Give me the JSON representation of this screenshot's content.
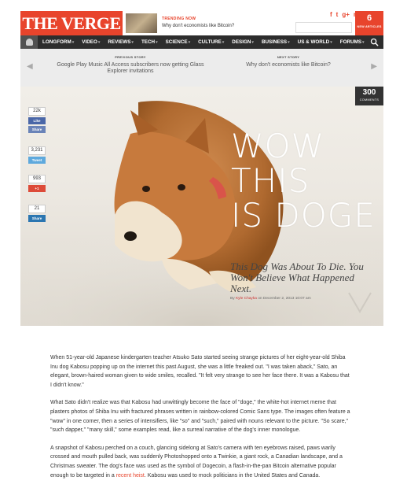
{
  "header": {
    "logo": "THE VERGE",
    "trending_kicker": "TRENDING NOW",
    "trending_title": "Why don't economists like Bitcoin?",
    "social_icons": [
      "f",
      "t",
      "g+",
      "rss"
    ],
    "new_articles_count": "6",
    "new_articles_label": "NEW ARTICLES"
  },
  "nav": {
    "items": [
      "LONGFORM",
      "VIDEO",
      "REVIEWS",
      "TECH",
      "SCIENCE",
      "CULTURE",
      "DESIGN",
      "BUSINESS",
      "US & WORLD",
      "FORUMS"
    ]
  },
  "prevnext": {
    "prev_kicker": "PREVIOUS STORY",
    "prev_title": "Google Play Music All Access subscribers now getting Glass Explorer invitations",
    "next_kicker": "NEXT STORY",
    "next_title": "Why don't economists like Bitcoin?"
  },
  "hero": {
    "title_lines": [
      "WOW",
      "THIS",
      "IS DOGE"
    ],
    "subtitle": "This Dog Was About To Die. You Won't Believe What Happened Next.",
    "byline_prefix": "By",
    "author": "Kyle Chayka",
    "date": "on December 2, 2013 10:07 am",
    "comments_count": "300",
    "comments_label": "COMMENTS"
  },
  "share": {
    "fb_count": "22k",
    "fb_like": "Like",
    "fb_share": "Share",
    "tweet_count": "3,231",
    "tweet_label": "Tweet",
    "gplus_count": "993",
    "gplus_label": "+1",
    "linkedin_count": "21",
    "linkedin_label": "Share"
  },
  "article": {
    "p1": "When 51-year-old Japanese kindergarten teacher Atsuko Sato started seeing strange pictures of her eight-year-old Shiba Inu dog Kabosu popping up on the internet this past August, she was a little freaked out. \"I was taken aback,\" Sato, an elegant, brown-haired woman given to wide smiles, recalled. \"It felt very strange to see her face there. It was a Kabosu that I didn't know.\"",
    "p2": "What Sato didn't realize was that Kabosu had unwittingly become the face of \"doge,\" the white-hot internet meme that plasters photos of Shiba Inu with fractured phrases written in rainbow-colored Comic Sans type. The images often feature a \"wow\" in one corner, then a series of intensifiers, like \"so\" and \"such,\" paired with nouns relevant to the picture. \"So scare,\" \"such dapper,\" \"many skill,\" some examples read, like a surreal narrative of the dog's inner monologue.",
    "p3_start": "A snapshot of Kabosu perched on a couch, glancing sidelong at Sato's camera with ten eyebrows raised, paws warily crossed and mouth pulled back, was suddenly Photoshopped onto a Twinkie, a giant rock, a Canadian landscape, and a Christmas sweater. The dog's face was used as the symbol of Dogecoin, a flash-in-the-pan Bitcoin alternative popular enough to be targeted in a",
    "p3_link": "recent heist",
    "p3_end": ". Kabosu was used to mock politicians in the United States and Canada."
  }
}
